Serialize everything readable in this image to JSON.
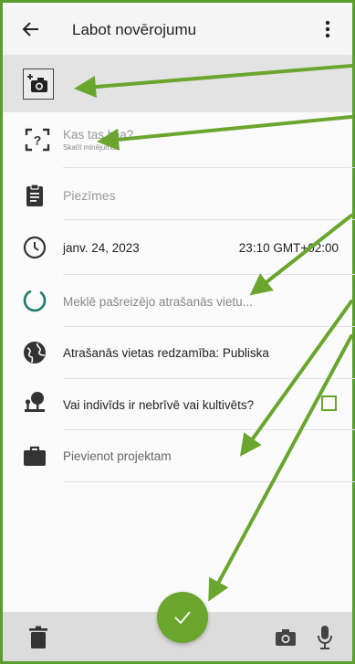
{
  "header": {
    "title": "Labot novērojumu",
    "back_icon": "arrow-back-icon",
    "menu_icon": "more-vert-icon"
  },
  "photos": {
    "add_photo_icon": "add-photo-icon"
  },
  "form": {
    "species_placeholder": "Kas tas bija?",
    "species_hint": "Skatīt minējumus",
    "notes_placeholder": "Piezīmes",
    "date": "janv. 24, 2023",
    "time": "23:10 GMT+02:00",
    "location_status": "Meklē pašreizējo atrašanās vietu...",
    "visibility": "Atrašanās vietas redzamība: Publiska",
    "captive_question": "Vai indivīds ir nebrīvē vai kultivēts?",
    "captive_checked": false,
    "project_placeholder": "Pievienot projektam"
  },
  "bottom_bar": {
    "delete_icon": "trash-icon",
    "camera_icon": "camera-icon",
    "mic_icon": "microphone-icon",
    "save_icon": "checkmark-icon"
  },
  "colors": {
    "accent": "#6aa52d",
    "annotation_arrows": "#6aa52d",
    "frame": "#5a9e2f"
  }
}
